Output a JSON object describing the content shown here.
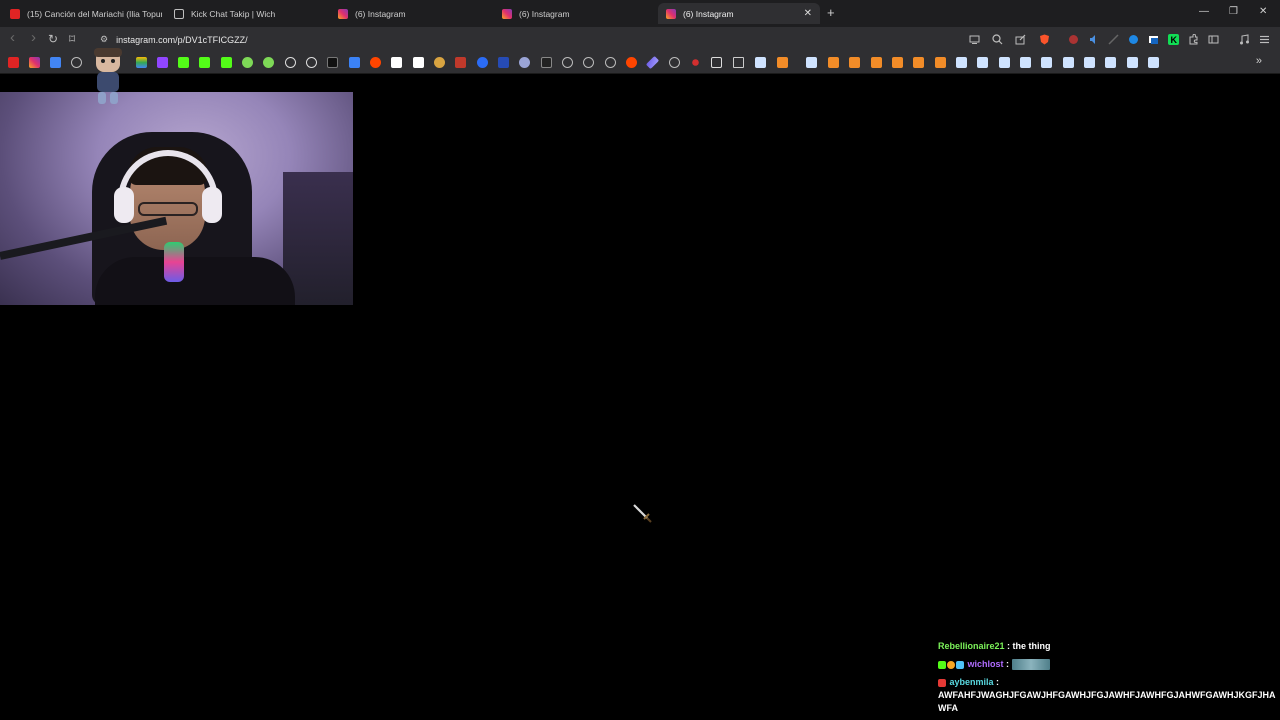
{
  "tabs": [
    {
      "title": "(15) Canción del Mariachi (Ilia Topuri",
      "favicon": "youtube-icon",
      "active": false
    },
    {
      "title": "Kick Chat Takip | Wich",
      "favicon": "globe-icon",
      "active": false
    },
    {
      "title": "(6) Instagram",
      "favicon": "instagram-icon",
      "active": false
    },
    {
      "title": "(6) Instagram",
      "favicon": "instagram-icon",
      "active": false
    },
    {
      "title": "(6) Instagram",
      "favicon": "instagram-icon",
      "active": true
    }
  ],
  "tab_close": "✕",
  "new_tab": "+",
  "window_controls": {
    "minimize": "—",
    "restore": "❐",
    "close": "✕"
  },
  "address": {
    "url": "instagram.com/p/DV1cTFICGZZ/"
  },
  "nav": {
    "back": "‹",
    "forward": "›",
    "reload": "↻",
    "bookmark": "⌑"
  },
  "bookmarks_overflow": "»",
  "colors": {
    "accent_green": "#53fc18",
    "chat_user_1": "#7cf25a",
    "chat_user_2": "#b06cff",
    "chat_user_3": "#59d8e0"
  },
  "chat": [
    {
      "user": "Rebellionaire21",
      "sep": " : ",
      "text": "the thing",
      "badges": []
    },
    {
      "user": "wichlost",
      "sep": " : ",
      "text": "",
      "badges": [
        "kick-icon",
        "gift-icon",
        "sub-icon"
      ],
      "emote": "emote-icon"
    },
    {
      "user": "aybenmila",
      "sep": " :",
      "text": "AWFAHFJWAGHJFGAWJHFGAWHJFGJAWHFJAWHFGJAHWFGAWHJKGFJHAWFA",
      "badges": [
        "kick-icon"
      ]
    }
  ]
}
